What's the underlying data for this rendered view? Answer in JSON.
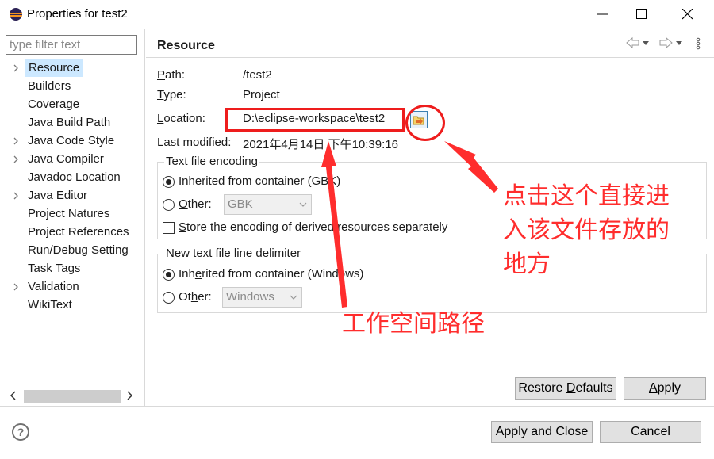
{
  "window": {
    "title": "Properties for test2",
    "controls": [
      "minimize-icon",
      "maximize-icon",
      "close-icon"
    ]
  },
  "filter": {
    "placeholder": "type filter text"
  },
  "tree": {
    "items": [
      {
        "label": "Resource",
        "expandable": true,
        "selected": true
      },
      {
        "label": "Builders",
        "expandable": false
      },
      {
        "label": "Coverage",
        "expandable": false
      },
      {
        "label": "Java Build Path",
        "expandable": false
      },
      {
        "label": "Java Code Style",
        "expandable": true
      },
      {
        "label": "Java Compiler",
        "expandable": true
      },
      {
        "label": "Javadoc Location",
        "expandable": false
      },
      {
        "label": "Java Editor",
        "expandable": true
      },
      {
        "label": "Project Natures",
        "expandable": false
      },
      {
        "label": "Project References",
        "expandable": false
      },
      {
        "label": "Run/Debug Setting",
        "expandable": false
      },
      {
        "label": "Task Tags",
        "expandable": false
      },
      {
        "label": "Validation",
        "expandable": true
      },
      {
        "label": "WikiText",
        "expandable": false
      }
    ]
  },
  "page": {
    "title": "Resource",
    "path_label_pre": "",
    "path_label_key": "P",
    "path_label_rest": "ath:",
    "path_value": "/test2",
    "type_label_pre": "",
    "type_label_key": "T",
    "type_label_rest": "ype:",
    "type_value": "Project",
    "location_label_pre": "",
    "location_label_key": "L",
    "location_label_rest": "ocation:",
    "location_value": "D:\\eclipse-workspace\\test2",
    "modified_label_pre": "Last ",
    "modified_label_key": "m",
    "modified_label_rest": "odified:",
    "modified_value": "2021年4月14日 下午10:39:16"
  },
  "encoding": {
    "group_title": "Text file encoding",
    "inherited_key": "I",
    "inherited_rest": "nherited from container (GBK)",
    "inherited_selected": true,
    "other_key": "O",
    "other_rest": "ther:",
    "other_value": "GBK",
    "store_pre": "S",
    "store_rest": "tore the encoding of derived resources separately",
    "store_checked": false
  },
  "delimiter": {
    "group_title": "New text file line delimiter",
    "inherited_pre": "Inh",
    "inherited_key": "e",
    "inherited_rest": "rited from container (Windows)",
    "inherited_selected": true,
    "other_pre": "Ot",
    "other_key": "h",
    "other_rest": "er:",
    "other_value": "Windows"
  },
  "buttons": {
    "restore_defaults_pre": "Restore ",
    "restore_defaults_key": "D",
    "restore_defaults_rest": "efaults",
    "apply_pre": "",
    "apply_key": "A",
    "apply_rest": "pply",
    "apply_and_close": "Apply and Close",
    "cancel": "Cancel"
  },
  "annotations": {
    "click_note_line1": "点击这个直接进",
    "click_note_line2": "入该文件存放的",
    "click_note_line3": "地方",
    "workspace_note": "工作空间路径",
    "color": "#ff2d2d"
  }
}
